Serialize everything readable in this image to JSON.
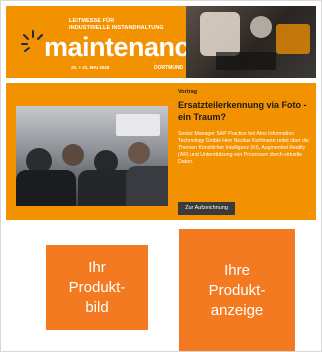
{
  "banner": {
    "fair_line1": "LEITMESSE FÜR",
    "fair_line2": "INDUSTRIELLE INSTANDHALTUNG",
    "logo_text": "maintenance",
    "date": "20. + 21. MAI 2025",
    "city": "DORTMUND"
  },
  "article": {
    "tag": "Vortrag",
    "title": "Ersatzteilerkennung via Foto - ein Traum?",
    "text": "Senior Manager SAP Practice bei Atos Information Technology GmbH Herr Nicolas Kuhlmann redet über die Themen Künstlicher Intelligenz (KI), Augmented Reality (AR) und Unterstützung von Prozessen durch virtuelle Daten.",
    "button": "Zur Aufzeichnung"
  },
  "ads": {
    "product_image": [
      "Ihr",
      "Produkt-",
      "bild"
    ],
    "product_ad": [
      "Ihre",
      "Produkt-",
      "anzeige"
    ]
  },
  "colors": {
    "brand_orange": "#f39200",
    "ad_orange": "#f37a21",
    "button_dark": "#3a3a3a"
  }
}
